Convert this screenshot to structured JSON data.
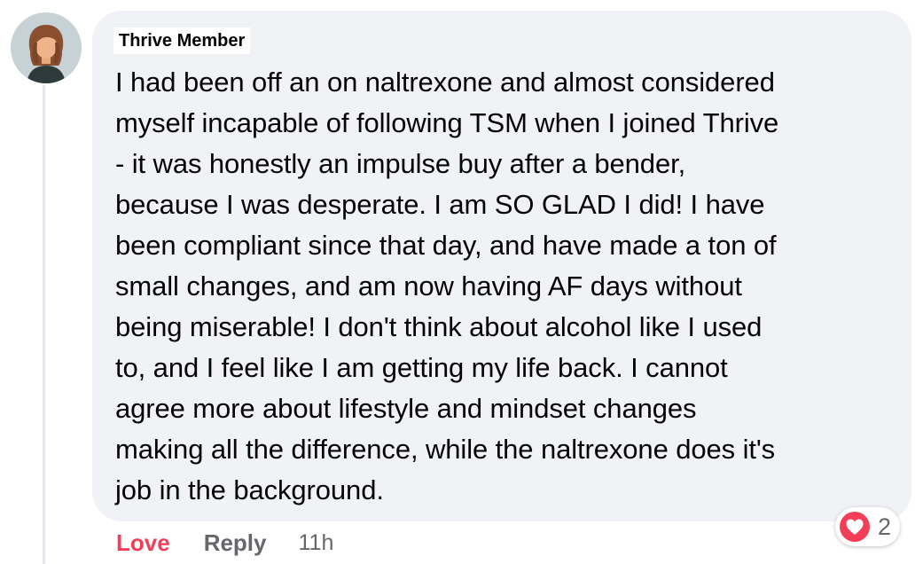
{
  "comment": {
    "author": "Thrive Member",
    "text_lines": [
      "I had been off an on naltrexone and almost considered",
      "myself incapable of following TSM when I joined Thrive",
      "- it was honestly an impulse buy after a bender,",
      "because I was desperate. I am SO GLAD I did! I have",
      "been compliant since that day, and have made a ton of",
      "small changes, and am now having AF days without",
      "being miserable! I don't think about alcohol like I used",
      "to, and I feel like I am getting my life back. I cannot",
      "agree more about lifestyle and mindset changes",
      "making all the difference, while the naltrexone does it's",
      "job in the background."
    ],
    "reaction": {
      "icon": "heart-icon",
      "count": "2",
      "color": "#f33e58"
    },
    "actions": {
      "love_label": "Love",
      "reply_label": "Reply",
      "timestamp": "11h"
    },
    "avatar_icon": "avatar-icon"
  },
  "colors": {
    "bubble": "#f0f2f5",
    "text": "#050505",
    "secondary": "#65676b",
    "love": "#f33e58"
  }
}
